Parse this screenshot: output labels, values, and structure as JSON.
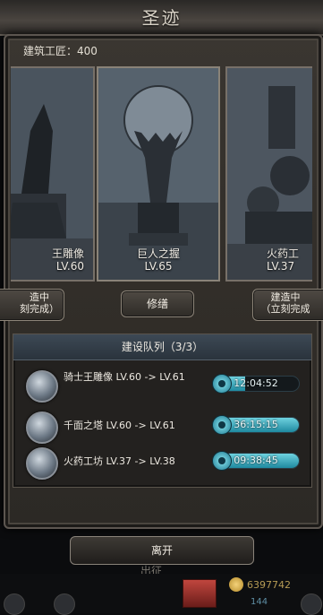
{
  "window": {
    "title": "圣迹"
  },
  "craftsman": {
    "label": "建筑工匠：400"
  },
  "monuments": [
    {
      "name": "王雕像",
      "level": "LV.60"
    },
    {
      "name": "巨人之握",
      "level": "LV.65"
    },
    {
      "name": "火药工",
      "level": "LV.37"
    }
  ],
  "buttons": {
    "left_status": "造中",
    "left_action": "刻完成）",
    "repair": "修缮",
    "right_status": "建造中",
    "right_action": "（立刻完成",
    "leave": "离开"
  },
  "queue": {
    "title": "建设队列（3/3）",
    "rows": [
      {
        "text": "骑士王雕像 LV.60 -> LV.61",
        "time": "12:04:52",
        "progress": 0.38
      },
      {
        "text": "千面之塔 LV.60 -> LV.61",
        "time": "36:15:15",
        "progress": 1.0
      },
      {
        "text": "火药工坊 LV.37 -> LV.38",
        "time": "09:38:45",
        "progress": 1.0
      }
    ]
  },
  "bottom": {
    "faint_label": "出征",
    "coins": "6397742",
    "gems": "144"
  },
  "colors": {
    "accent": "#1f8aa0",
    "frame": "#3a3631"
  }
}
